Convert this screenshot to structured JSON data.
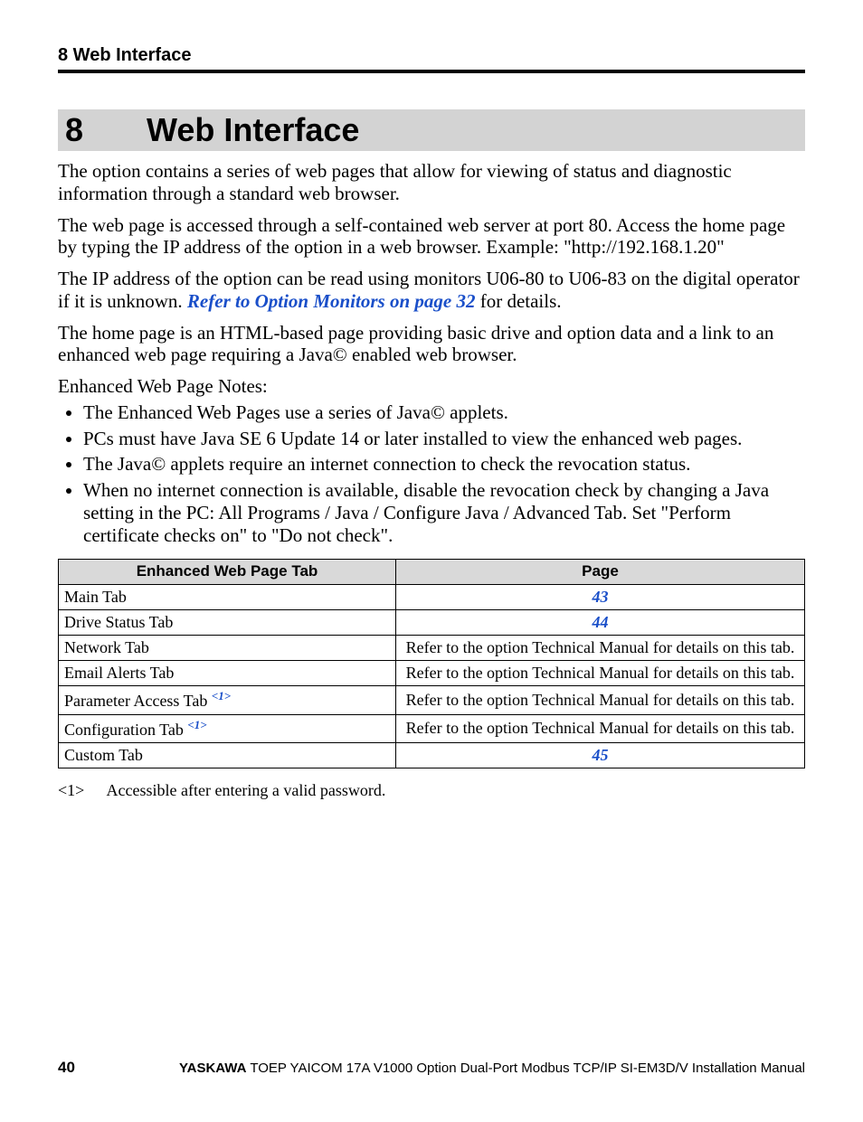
{
  "header": {
    "running": "8  Web Interface"
  },
  "chapter": {
    "number": "8",
    "title": "Web Interface"
  },
  "paragraphs": {
    "p1": "The option contains a series of web pages that allow for viewing of status and diagnostic information through a standard web browser.",
    "p2": "The web page is accessed through a self-contained web server at port 80. Access the home page by typing the IP address of the option in a web browser. Example: \"http://192.168.1.20\"",
    "p3a": "The IP address of the option can be read using monitors U06-80 to U06-83 on the digital operator if it is unknown. ",
    "p3_link": "Refer to Option Monitors on page 32",
    "p3b": " for details.",
    "p4": "The home page is an HTML-based page providing basic drive and option data and a link to an enhanced web page requiring a Java© enabled web browser.",
    "p5": "Enhanced Web Page Notes:"
  },
  "notes": [
    "The Enhanced Web Pages use a series of Java© applets.",
    "PCs must have Java SE 6 Update 14 or later installed to view the enhanced web pages.",
    "The Java© applets require an internet connection to check the revocation status.",
    "When no internet connection is available, disable the revocation check by changing a Java setting in the PC: All Programs / Java / Configure Java / Advanced Tab. Set \"Perform certificate checks on\" to \"Do not check\"."
  ],
  "table": {
    "headers": {
      "c1": "Enhanced Web Page Tab",
      "c2": "Page"
    },
    "rows": [
      {
        "tab": "Main Tab",
        "note": "",
        "page": "43",
        "link": true
      },
      {
        "tab": "Drive Status Tab",
        "note": "",
        "page": "44",
        "link": true
      },
      {
        "tab": "Network Tab",
        "note": "",
        "page": "Refer to the option Technical Manual for details on this tab.",
        "link": false
      },
      {
        "tab": "Email Alerts Tab",
        "note": "",
        "page": "Refer to the option Technical Manual for details on this tab.",
        "link": false
      },
      {
        "tab": "Parameter Access Tab ",
        "note": "<1>",
        "page": "Refer to the option Technical Manual for details on this tab.",
        "link": false
      },
      {
        "tab": "Configuration Tab ",
        "note": "<1>",
        "page": "Refer to the option Technical Manual for details on this tab.",
        "link": false
      },
      {
        "tab": "Custom Tab",
        "note": "",
        "page": "45",
        "link": true
      }
    ]
  },
  "footnote": {
    "key": "<1>",
    "text": "Accessible after entering a valid password."
  },
  "footer": {
    "page_number": "40",
    "brand": "YASKAWA",
    "rest": " TOEP YAICOM 17A V1000 Option Dual-Port Modbus TCP/IP SI-EM3D/V Installation Manual"
  }
}
